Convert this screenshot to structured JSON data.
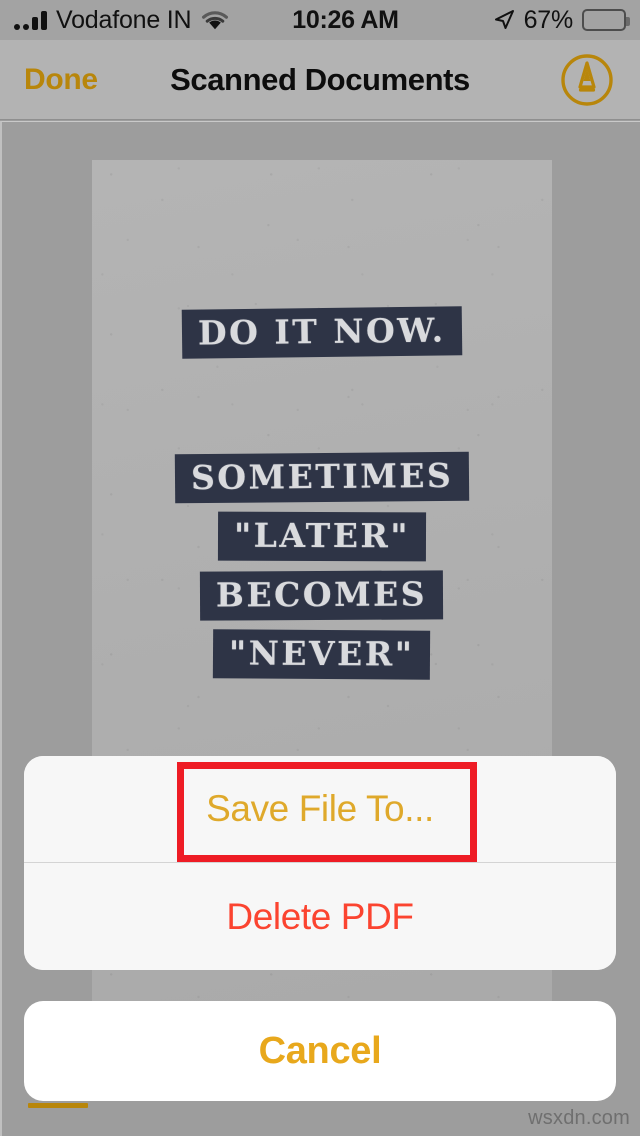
{
  "status_bar": {
    "carrier": "Vodafone IN",
    "time": "10:26 AM",
    "battery_percent": "67%",
    "battery_level": 67,
    "signal_icon": "signal-bars-icon",
    "wifi_icon": "wifi-icon",
    "location_icon": "location-arrow-icon",
    "battery_icon": "battery-icon"
  },
  "nav_bar": {
    "done_label": "Done",
    "title": "Scanned Documents",
    "markup_icon": "markup-pen-icon"
  },
  "document": {
    "poster_lines": [
      "DO IT NOW.",
      "SOMETIMES",
      "\"LATER\"",
      "BECOMES",
      "\"NEVER\""
    ]
  },
  "action_sheet": {
    "buttons": [
      {
        "label": "Save File To...",
        "style": "default"
      },
      {
        "label": "Delete PDF",
        "style": "destructive"
      }
    ],
    "cancel_label": "Cancel"
  },
  "annotation": {
    "highlight_target": "Save File To...",
    "color": "#ee1c25"
  },
  "watermark": "wsxdn.com",
  "colors": {
    "tint": "#dfa92b",
    "destructive": "#fb4430",
    "nav_done": "#b8860b",
    "annotation_red": "#ee1c25",
    "background": "#9d9d9d"
  }
}
